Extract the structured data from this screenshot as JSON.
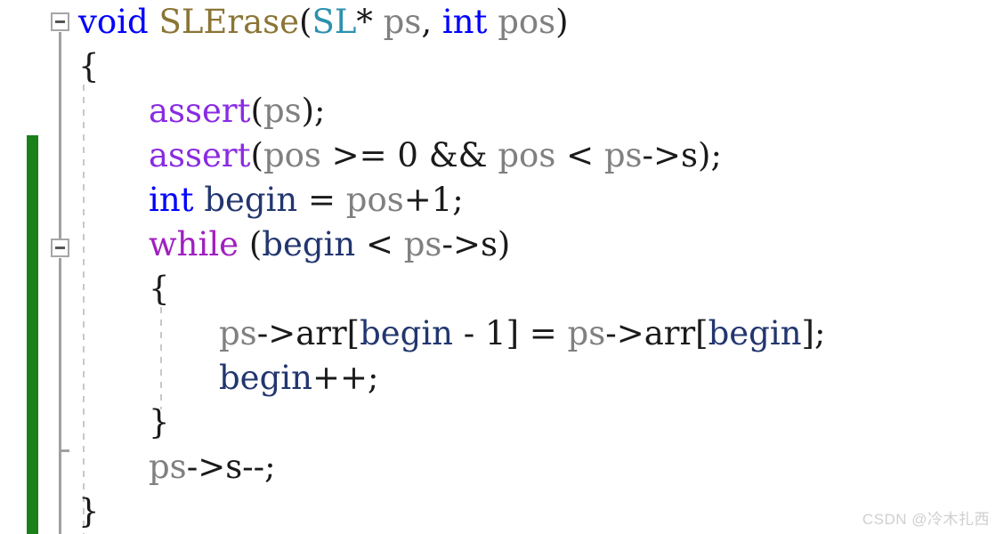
{
  "editor": {
    "language": "c",
    "background_color": "#ffffff",
    "font_size_px": 37,
    "line_height_px": 50
  },
  "gutter": {
    "change_bar": {
      "color": "#1a8017",
      "label": "unsaved-change-indicator"
    },
    "fold_markers": [
      {
        "state": "expanded",
        "glyph": "−",
        "target_line": 1
      },
      {
        "state": "expanded",
        "glyph": "−",
        "target_line": 6
      }
    ]
  },
  "colors": {
    "keyword": "#0000ff",
    "function": "#8b7536",
    "type": "#2b91af",
    "variable": "#808080",
    "macro": "#8a2be2",
    "control": "#a020c0",
    "local": "#22366f",
    "plain": "#1a1a1a",
    "change_bar": "#1a8017",
    "watermark": "#cfcfcf"
  },
  "code": {
    "lines": [
      {
        "number": 1,
        "indent": 0,
        "tokens": [
          {
            "text": "void",
            "cls": "t-kw"
          },
          {
            "text": " ",
            "cls": "t-plain"
          },
          {
            "text": "SLErase",
            "cls": "t-fn"
          },
          {
            "text": "(",
            "cls": "t-plain"
          },
          {
            "text": "SL",
            "cls": "t-type"
          },
          {
            "text": "* ",
            "cls": "t-plain"
          },
          {
            "text": "ps",
            "cls": "t-var"
          },
          {
            "text": ", ",
            "cls": "t-plain"
          },
          {
            "text": "int",
            "cls": "t-kw"
          },
          {
            "text": " ",
            "cls": "t-plain"
          },
          {
            "text": "pos",
            "cls": "t-var"
          },
          {
            "text": ")",
            "cls": "t-plain"
          }
        ]
      },
      {
        "number": 2,
        "indent": 0,
        "tokens": [
          {
            "text": "{",
            "cls": "t-brace"
          }
        ]
      },
      {
        "number": 3,
        "indent": 1,
        "tokens": [
          {
            "text": "assert",
            "cls": "t-macro"
          },
          {
            "text": "(",
            "cls": "t-plain"
          },
          {
            "text": "ps",
            "cls": "t-var"
          },
          {
            "text": ");",
            "cls": "t-plain"
          }
        ]
      },
      {
        "number": 4,
        "indent": 1,
        "tokens": [
          {
            "text": "assert",
            "cls": "t-macro"
          },
          {
            "text": "(",
            "cls": "t-plain"
          },
          {
            "text": "pos",
            "cls": "t-var"
          },
          {
            "text": " >= 0 && ",
            "cls": "t-plain"
          },
          {
            "text": "pos",
            "cls": "t-var"
          },
          {
            "text": " < ",
            "cls": "t-plain"
          },
          {
            "text": "ps",
            "cls": "t-var"
          },
          {
            "text": "->s);",
            "cls": "t-plain"
          }
        ]
      },
      {
        "number": 5,
        "indent": 1,
        "tokens": [
          {
            "text": "int",
            "cls": "t-kw"
          },
          {
            "text": " ",
            "cls": "t-plain"
          },
          {
            "text": "begin",
            "cls": "t-local"
          },
          {
            "text": " = ",
            "cls": "t-plain"
          },
          {
            "text": "pos",
            "cls": "t-var"
          },
          {
            "text": "+1;",
            "cls": "t-plain"
          }
        ]
      },
      {
        "number": 6,
        "indent": 1,
        "tokens": [
          {
            "text": "while",
            "cls": "t-ctrl"
          },
          {
            "text": " (",
            "cls": "t-plain"
          },
          {
            "text": "begin",
            "cls": "t-local"
          },
          {
            "text": " < ",
            "cls": "t-plain"
          },
          {
            "text": "ps",
            "cls": "t-var"
          },
          {
            "text": "->s)",
            "cls": "t-plain"
          }
        ]
      },
      {
        "number": 7,
        "indent": 1,
        "tokens": [
          {
            "text": "{",
            "cls": "t-brace"
          }
        ]
      },
      {
        "number": 8,
        "indent": 2,
        "tokens": [
          {
            "text": "ps",
            "cls": "t-var"
          },
          {
            "text": "->arr[",
            "cls": "t-plain"
          },
          {
            "text": "begin",
            "cls": "t-local"
          },
          {
            "text": " - 1] = ",
            "cls": "t-plain"
          },
          {
            "text": "ps",
            "cls": "t-var"
          },
          {
            "text": "->arr[",
            "cls": "t-plain"
          },
          {
            "text": "begin",
            "cls": "t-local"
          },
          {
            "text": "];",
            "cls": "t-plain"
          }
        ]
      },
      {
        "number": 9,
        "indent": 2,
        "tokens": [
          {
            "text": "begin",
            "cls": "t-local"
          },
          {
            "text": "++;",
            "cls": "t-plain"
          }
        ]
      },
      {
        "number": 10,
        "indent": 1,
        "tokens": [
          {
            "text": "}",
            "cls": "t-brace"
          }
        ]
      },
      {
        "number": 11,
        "indent": 1,
        "tokens": [
          {
            "text": "ps",
            "cls": "t-var"
          },
          {
            "text": "->s--;",
            "cls": "t-plain"
          }
        ]
      },
      {
        "number": 12,
        "indent": 0,
        "tokens": [
          {
            "text": "}",
            "cls": "t-brace"
          }
        ]
      }
    ]
  },
  "watermark": {
    "text": "CSDN @冷木扎西"
  }
}
